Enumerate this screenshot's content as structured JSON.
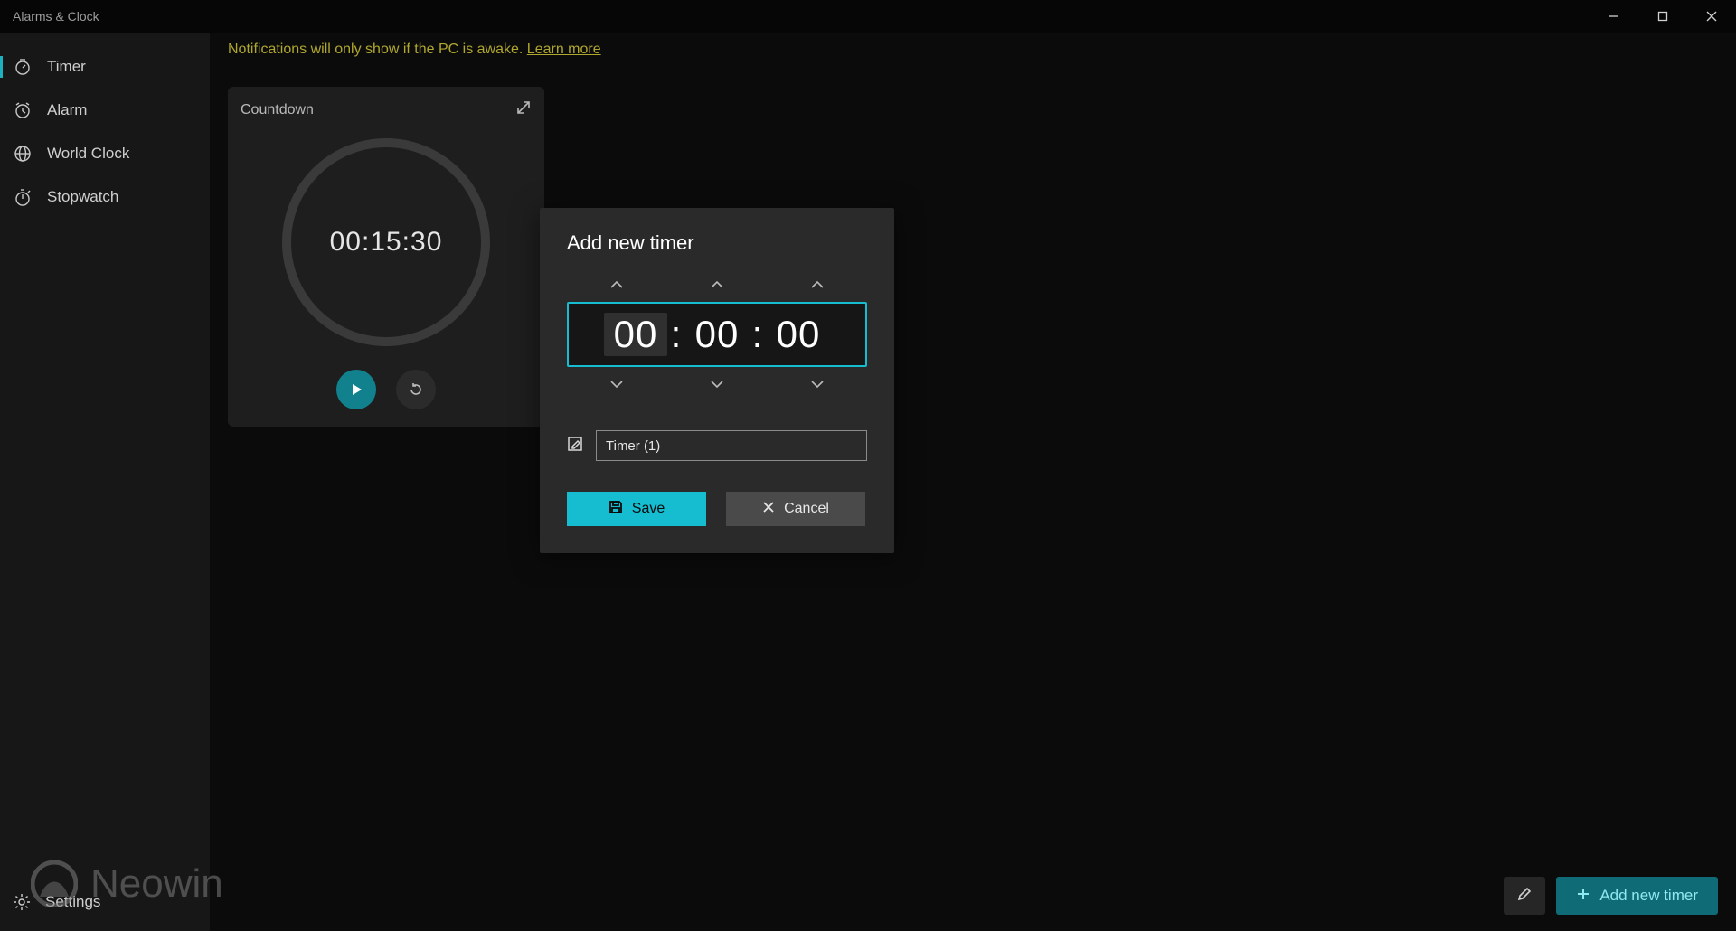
{
  "app_title": "Alarms & Clock",
  "sidebar": {
    "items": [
      {
        "label": "Timer",
        "active": true
      },
      {
        "label": "Alarm",
        "active": false
      },
      {
        "label": "World Clock",
        "active": false
      },
      {
        "label": "Stopwatch",
        "active": false
      }
    ],
    "settings_label": "Settings"
  },
  "notification": {
    "text": "Notifications will only show if the PC is awake. ",
    "link_text": "Learn more"
  },
  "timer_card": {
    "title": "Countdown",
    "time_display": "00:15:30"
  },
  "dialog": {
    "title": "Add new timer",
    "hours": "00",
    "minutes": "00",
    "seconds": "00",
    "timer_name_value": "Timer (1)",
    "save_label": "Save",
    "cancel_label": "Cancel"
  },
  "bottom_bar": {
    "add_new_timer_label": "Add new timer"
  },
  "watermark": {
    "text": "Neowin"
  },
  "colors": {
    "accent": "#16bccf",
    "accent_dark": "#0f6b76"
  }
}
